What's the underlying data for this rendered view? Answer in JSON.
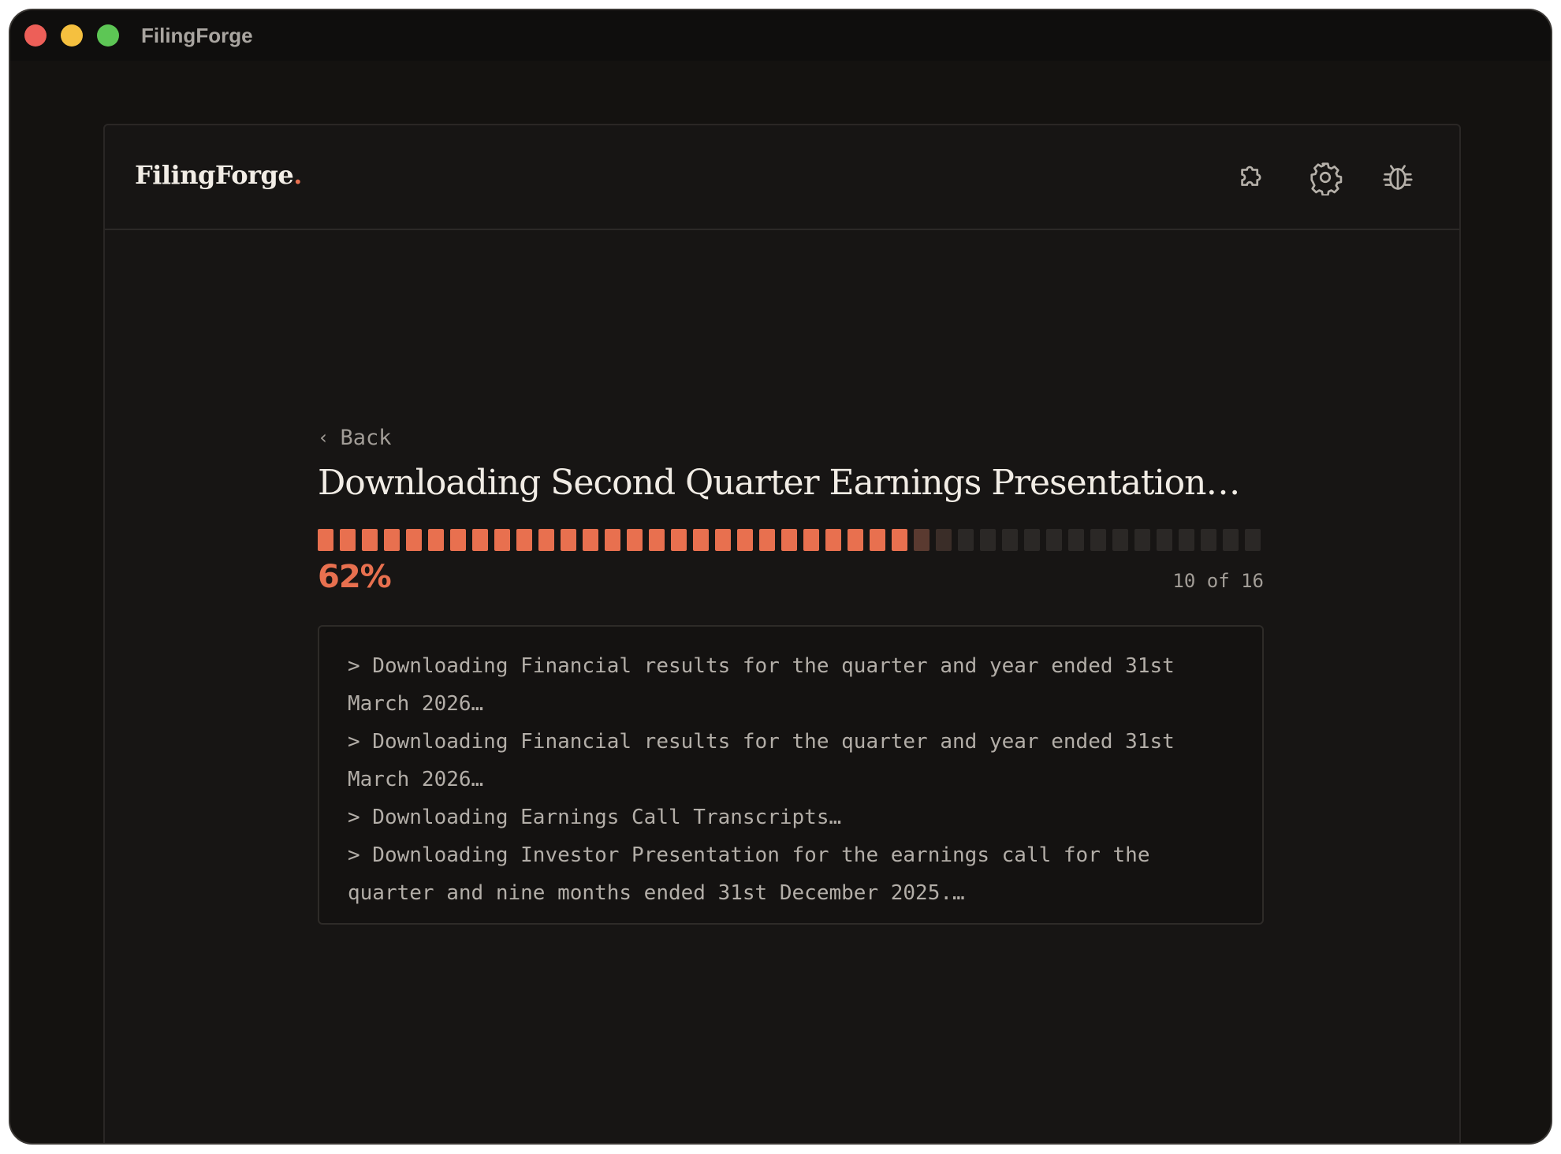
{
  "window": {
    "title": "FilingForge"
  },
  "header": {
    "brand_name": "FilingForge",
    "brand_dot": ".",
    "icons": [
      "puzzle-icon",
      "gear-icon",
      "bug-icon"
    ]
  },
  "main": {
    "back_label": "Back",
    "back_chevron": "‹",
    "headline": "Downloading Second Quarter Earnings Presentation…",
    "progress": {
      "percent_label": "62%",
      "fraction": 0.62,
      "count_label": "10 of 16"
    },
    "log": [
      "> Downloading Financial results for the quarter and year ended 31st March 2026…",
      "> Downloading Financial results for the quarter and year ended 31st March 2026…",
      "> Downloading Earnings Call Transcripts…",
      "> Downloading Investor Presentation for the earnings call for the quarter and nine months ended 31st December 2025.…"
    ]
  },
  "colors": {
    "accent": "#e8704f",
    "background": "#141210",
    "text_primary": "#f1ece5",
    "text_muted": "#a29d97"
  }
}
